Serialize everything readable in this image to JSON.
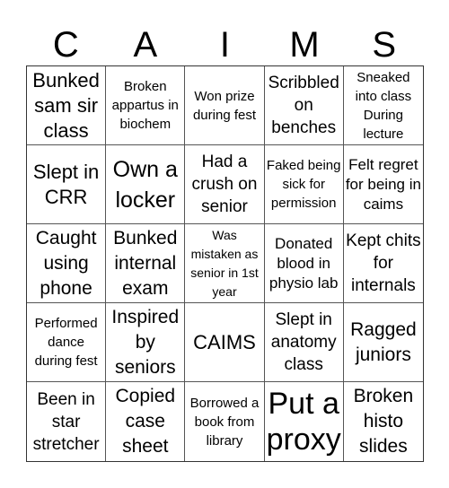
{
  "header": {
    "letters": [
      "C",
      "A",
      "I",
      "M",
      "S"
    ]
  },
  "cells": [
    "Bunked sam sir class",
    "Broken appartus in biochem",
    "Won prize during fest",
    "Scribbled on benches",
    "Sneaked into class During lecture",
    "Slept in CRR",
    "Own a locker",
    "Had a crush on senior",
    "Faked being sick for permission",
    "Felt regret for being in caims",
    "Caught using phone",
    "Bunked internal exam",
    "Was mistaken as senior in 1st year",
    "Donated blood in physio lab",
    "Kept chits for internals",
    "Performed dance during fest",
    "Inspired by seniors",
    "CAIMS",
    "Slept in anatomy class",
    "Ragged juniors",
    "Been in star stretcher",
    "Copied case sheet",
    "Borrowed a book from library",
    "Put a proxy",
    "Broken histo slides"
  ]
}
